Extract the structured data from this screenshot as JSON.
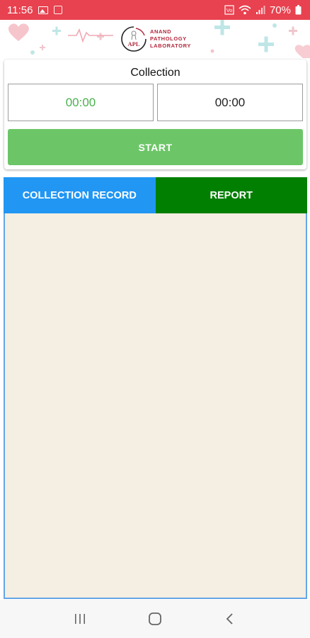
{
  "status_bar": {
    "time": "11:56",
    "battery": "70%",
    "bg_color": "#e8414f",
    "icons": [
      "image-icon",
      "app-notification-icon",
      "volte-icon",
      "wifi-icon",
      "signal-icon",
      "battery-icon"
    ]
  },
  "header": {
    "logo_initials": "APL",
    "logo_lines": [
      "ANAND",
      "PATHOLOGY",
      "LABORATORY"
    ]
  },
  "collection": {
    "title": "Collection",
    "time_left": "00:00",
    "time_right": "00:00",
    "start_label": "START",
    "start_color": "#6cc667"
  },
  "tabs": [
    {
      "label": "COLLECTION RECORD",
      "color": "#2196f3"
    },
    {
      "label": "REPORT",
      "color": "#007f00"
    }
  ],
  "content": {
    "bg_color": "#f5eee2"
  },
  "nav_bar": {
    "icons": [
      "recent-apps-icon",
      "home-icon",
      "back-icon"
    ]
  }
}
